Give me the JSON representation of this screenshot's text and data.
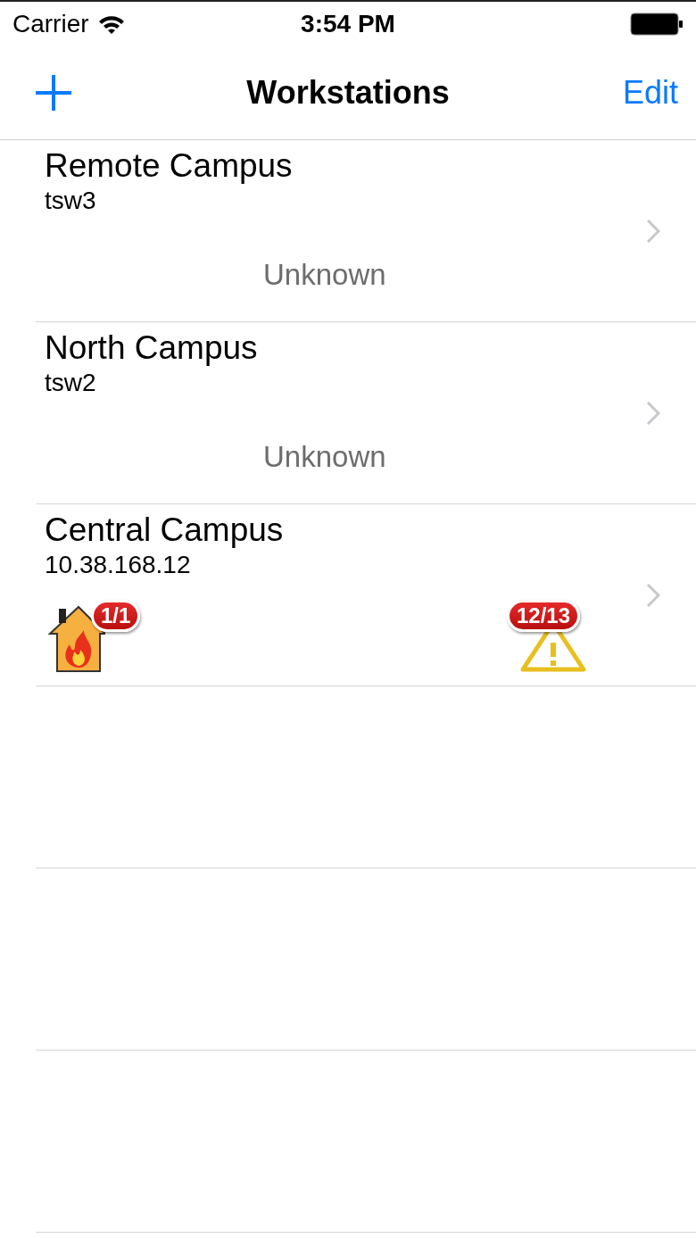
{
  "status_bar": {
    "carrier": "Carrier",
    "time": "3:54 PM"
  },
  "nav_bar": {
    "title": "Workstations",
    "edit": "Edit"
  },
  "workstations": [
    {
      "name": "Remote Campus",
      "host": "tsw3",
      "kind": "status",
      "status": "Unknown"
    },
    {
      "name": "North Campus",
      "host": "tsw2",
      "kind": "status",
      "status": "Unknown"
    },
    {
      "name": "Central Campus",
      "host": "10.38.168.12",
      "kind": "alerts",
      "fire_count": "1/1",
      "warning_count": "12/13"
    }
  ]
}
